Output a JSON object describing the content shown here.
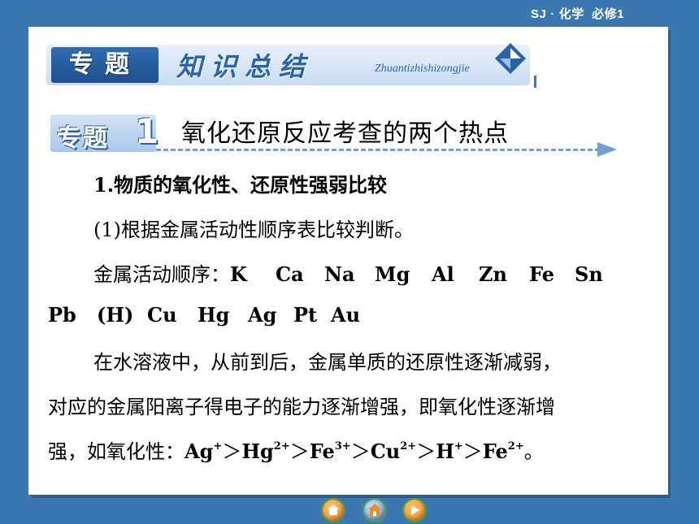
{
  "top_label": {
    "course": "SJ",
    "separator": "·",
    "subject": "化学",
    "book": "必修1"
  },
  "header": {
    "tag": "专题",
    "title": "知识总结",
    "pinyin": "Zhuantizhishizongjie"
  },
  "section": {
    "tag": "专题",
    "number": "1",
    "title": "氧化还原反应考查的两个热点"
  },
  "content": {
    "heading1": "1.物质的氧化性、还原性强弱比较",
    "heading2": "(1)根据金属活动性顺序表比较判断。",
    "sequence_label": "金属活动顺序：",
    "metals_line1": [
      "K",
      "Ca",
      "Na",
      "Mg",
      "Al",
      "Zn",
      "Fe",
      "Sn"
    ],
    "metals_line2": [
      "Pb",
      "(H)",
      "Cu",
      "Hg",
      "Ag",
      "Pt",
      "Au"
    ],
    "para_line1": "在水溶液中，从前到后，金属单质的还原性逐渐减弱，",
    "para_line2": "对应的金属阳离子得电子的能力逐渐增强，即氧化性逐渐增",
    "para_line3_prefix": "强，如氧化性：",
    "ions": [
      {
        "symbol": "Ag",
        "charge": "+"
      },
      {
        "symbol": "Hg",
        "charge": "2+"
      },
      {
        "symbol": "Fe",
        "charge": "3+"
      },
      {
        "symbol": "Cu",
        "charge": "2+"
      },
      {
        "symbol": "H",
        "charge": "+"
      },
      {
        "symbol": "Fe",
        "charge": "2+"
      }
    ],
    "gt": "＞",
    "end_punct": "。"
  },
  "colors": {
    "background": "#3b77b1",
    "accent": "#2a64a8",
    "nav_orange": "#f08c1e",
    "nav_blue": "#4a8fd6",
    "nav_green": "#6cbf3a"
  },
  "nav": [
    {
      "name": "home-icon"
    },
    {
      "name": "house-icon"
    },
    {
      "name": "next-icon"
    }
  ]
}
